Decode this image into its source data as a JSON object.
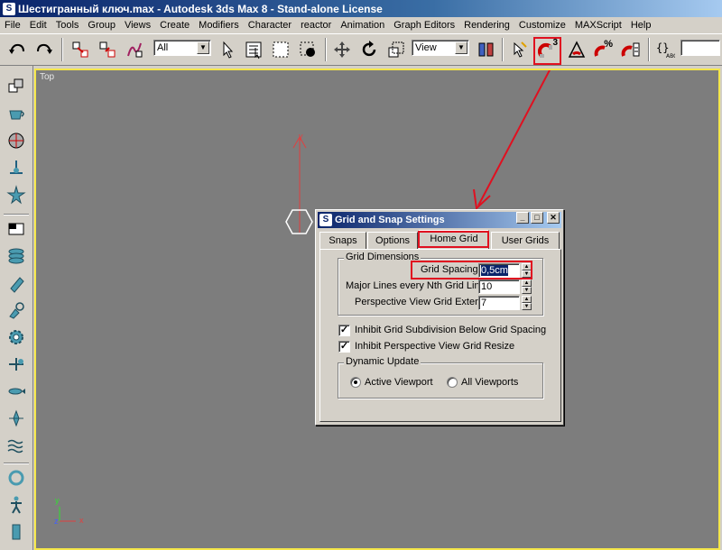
{
  "window": {
    "title": "Шестигранный ключ.max - Autodesk 3ds Max 8  - Stand-alone License"
  },
  "menu": [
    "File",
    "Edit",
    "Tools",
    "Group",
    "Views",
    "Create",
    "Modifiers",
    "Character",
    "reactor",
    "Animation",
    "Graph Editors",
    "Rendering",
    "Customize",
    "MAXScript",
    "Help"
  ],
  "toolbar": {
    "selection_filter": "All",
    "reference_coord": "View",
    "snap_toggle_badge": "3",
    "percent_snap_symbol": "%"
  },
  "viewport": {
    "label": "Top",
    "axis_y": "y",
    "axis_x": "x",
    "axis_z": "z"
  },
  "dialog": {
    "title": "Grid and Snap Settings",
    "tabs": [
      "Snaps",
      "Options",
      "Home Grid",
      "User Grids"
    ],
    "active_tab": "Home Grid",
    "grid_dimensions": {
      "legend": "Grid Dimensions",
      "grid_spacing_label": "Grid Spacing:",
      "grid_spacing_value": "0,5cm",
      "major_lines_label": "Major Lines every Nth Grid Line:",
      "major_lines_value": "10",
      "perspective_extent_label": "Perspective View Grid Extent:",
      "perspective_extent_value": "7"
    },
    "checkboxes": [
      {
        "label": "Inhibit Grid Subdivision Below Grid Spacing",
        "checked": true
      },
      {
        "label": "Inhibit Perspective View Grid Resize",
        "checked": true
      }
    ],
    "dynamic_update": {
      "legend": "Dynamic Update",
      "options": [
        "Active Viewport",
        "All Viewports"
      ],
      "selected": "Active Viewport"
    }
  },
  "colors": {
    "annotation": "#e01020",
    "viewport_bg": "#7d7d7d",
    "viewport_border": "#f4e64a"
  }
}
